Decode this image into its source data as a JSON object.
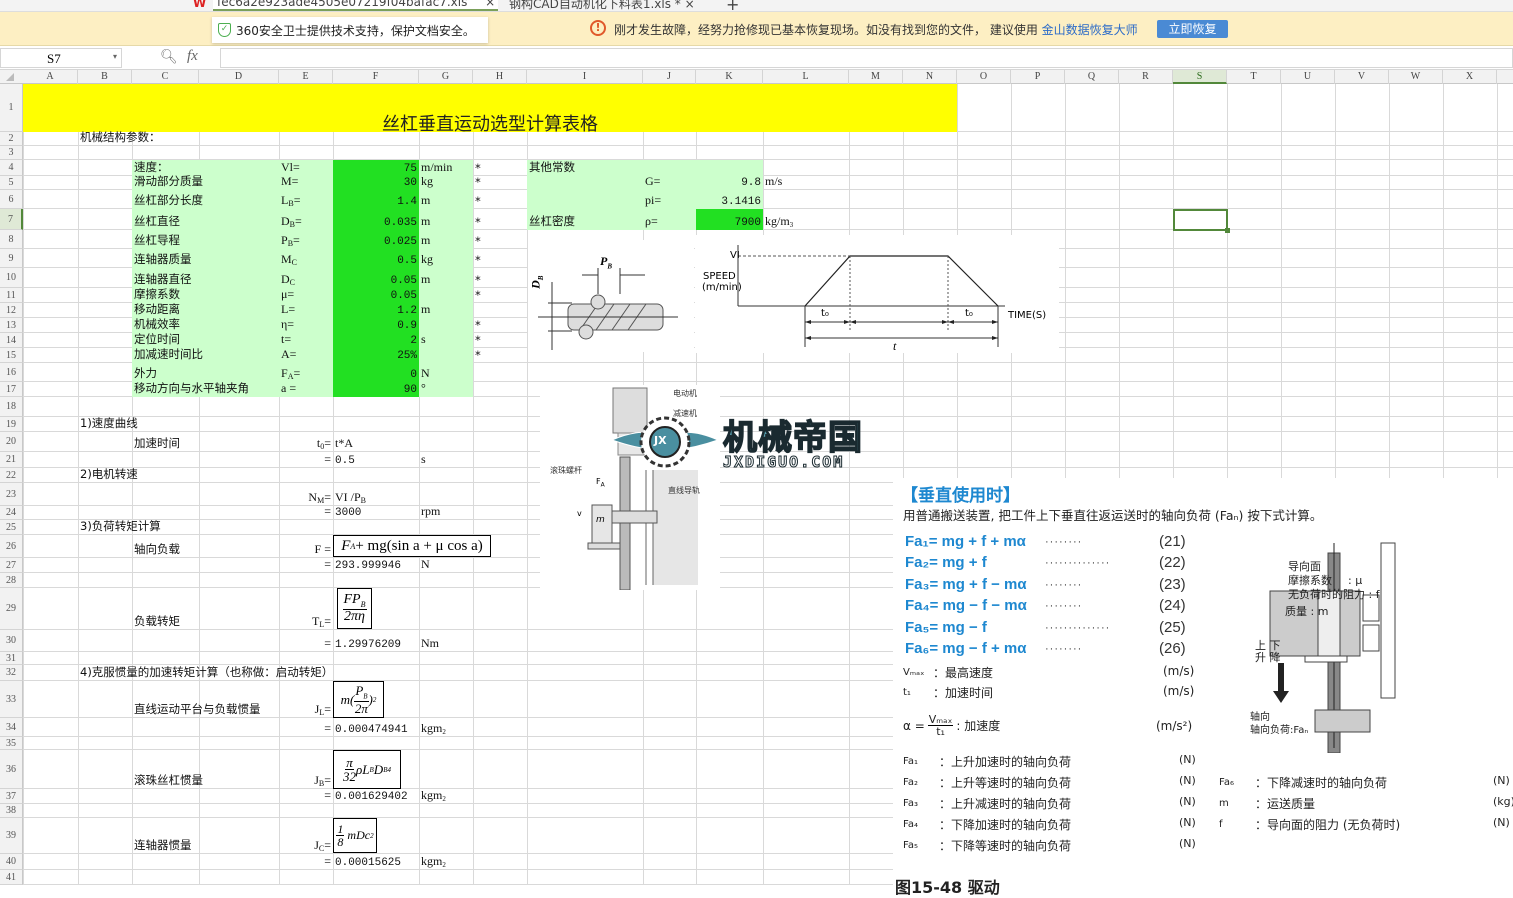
{
  "tabs": [
    {
      "label": "fec6a2e923ade4505e07219f04bafac7.xls",
      "close": "×"
    },
    {
      "label": "钢构CAD自动机化下料表1.xls *",
      "close": "×"
    }
  ],
  "tab_add": "+",
  "notice": {
    "security": "360安全卫士提供技术支持，保护文档安全。",
    "message": "刚才发生故障，经努力抢修现已基本恢复现场。如没有找到您的文件， 建议使用",
    "link": "金山数据恢复大师",
    "button": "立即恢复",
    "warning_color": "#e0582a",
    "button_color": "#4a8ad4"
  },
  "formula_bar": {
    "name_box": "S7",
    "fx": "fx",
    "value": ""
  },
  "columns": [
    "A",
    "B",
    "C",
    "D",
    "E",
    "F",
    "G",
    "H",
    "I",
    "J",
    "K",
    "L",
    "M",
    "N",
    "O",
    "P",
    "Q",
    "R",
    "S",
    "T",
    "U",
    "V",
    "W",
    "X"
  ],
  "selected_cell": {
    "col": "S",
    "row": 7
  },
  "sheet": {
    "title": "丝杠垂直运动选型计算表格",
    "cells": [
      {
        "ref": "B2",
        "text": "机械结构参数："
      },
      {
        "ref": "C4",
        "text": "速度："
      },
      {
        "ref": "E4",
        "text": "Vl="
      },
      {
        "ref": "F4",
        "text": "75"
      },
      {
        "ref": "G4",
        "text": "m/min"
      },
      {
        "ref": "H4",
        "text": "*"
      },
      {
        "ref": "C5",
        "text": "滑动部分质量"
      },
      {
        "ref": "E5",
        "text": "M="
      },
      {
        "ref": "F5",
        "text": "30"
      },
      {
        "ref": "G5",
        "text": "kg"
      },
      {
        "ref": "H5",
        "text": "*"
      },
      {
        "ref": "C6",
        "text": "丝杠部分长度"
      },
      {
        "ref": "E6",
        "text": "L",
        "sub": "B",
        "tail": "="
      },
      {
        "ref": "F6",
        "text": "1.4"
      },
      {
        "ref": "G6",
        "text": "m"
      },
      {
        "ref": "H6",
        "text": "*"
      },
      {
        "ref": "C7",
        "text": "丝杠直径"
      },
      {
        "ref": "E7",
        "text": "D",
        "sub": "B",
        "tail": "="
      },
      {
        "ref": "F7",
        "text": "0.035"
      },
      {
        "ref": "G7",
        "text": "m"
      },
      {
        "ref": "H7",
        "text": "*"
      },
      {
        "ref": "C8",
        "text": "丝杠导程"
      },
      {
        "ref": "E8",
        "text": "P",
        "sub": "B",
        "tail": "="
      },
      {
        "ref": "F8",
        "text": "0.025"
      },
      {
        "ref": "G8",
        "text": "m"
      },
      {
        "ref": "H8",
        "text": "*"
      },
      {
        "ref": "C9",
        "text": "连轴器质量"
      },
      {
        "ref": "E9",
        "text": "M",
        "sub": "C",
        "tail": ""
      },
      {
        "ref": "F9",
        "text": "0.5"
      },
      {
        "ref": "G9",
        "text": "kg"
      },
      {
        "ref": "H9",
        "text": "*"
      },
      {
        "ref": "C10",
        "text": "连轴器直径"
      },
      {
        "ref": "E10",
        "text": "D",
        "sub": "C",
        "tail": ""
      },
      {
        "ref": "F10",
        "text": "0.05"
      },
      {
        "ref": "G10",
        "text": "m"
      },
      {
        "ref": "H10",
        "text": "*"
      },
      {
        "ref": "C11",
        "text": "摩擦系数"
      },
      {
        "ref": "E11",
        "text": "μ="
      },
      {
        "ref": "F11",
        "text": "0.05"
      },
      {
        "ref": "H11",
        "text": "*"
      },
      {
        "ref": "C12",
        "text": "移动距离"
      },
      {
        "ref": "E12",
        "text": "L="
      },
      {
        "ref": "F12",
        "text": "1.2"
      },
      {
        "ref": "G12",
        "text": "m"
      },
      {
        "ref": "C13",
        "text": "机械效率"
      },
      {
        "ref": "E13",
        "text": "η="
      },
      {
        "ref": "F13",
        "text": "0.9"
      },
      {
        "ref": "H13",
        "text": "*"
      },
      {
        "ref": "C14",
        "text": "定位时间"
      },
      {
        "ref": "E14",
        "text": "t="
      },
      {
        "ref": "F14",
        "text": "2"
      },
      {
        "ref": "G14",
        "text": "s"
      },
      {
        "ref": "H14",
        "text": "*"
      },
      {
        "ref": "C15",
        "text": "加减速时间比"
      },
      {
        "ref": "E15",
        "text": "A="
      },
      {
        "ref": "F15",
        "text": "25%"
      },
      {
        "ref": "H15",
        "text": "*"
      },
      {
        "ref": "C16",
        "text": "外力"
      },
      {
        "ref": "E16",
        "text": "F",
        "sub": "A",
        "tail": "="
      },
      {
        "ref": "F16",
        "text": "0"
      },
      {
        "ref": "G16",
        "text": "N"
      },
      {
        "ref": "C17",
        "text": "移动方向与水平轴夹角"
      },
      {
        "ref": "E17",
        "text": "a ="
      },
      {
        "ref": "F17",
        "text": "90"
      },
      {
        "ref": "G17",
        "text": "°"
      },
      {
        "ref": "I4",
        "text": "其他常数"
      },
      {
        "ref": "J5",
        "text": "G="
      },
      {
        "ref": "K5",
        "text": "9.8"
      },
      {
        "ref": "L5",
        "text": "m/s"
      },
      {
        "ref": "J6",
        "text": "pi="
      },
      {
        "ref": "K6",
        "text": "3.1416"
      },
      {
        "ref": "I7",
        "text": "丝杠密度"
      },
      {
        "ref": "J7",
        "text": "ρ="
      },
      {
        "ref": "K7",
        "text": "7900"
      },
      {
        "ref": "L7",
        "text": "kg/m",
        "sup": "3"
      },
      {
        "ref": "B19",
        "text": "1)速度曲线"
      },
      {
        "ref": "C20",
        "text": "加速时间"
      },
      {
        "ref": "E20",
        "text": "t",
        "sub": "0",
        "tail": "="
      },
      {
        "ref": "F20",
        "text": "t*A"
      },
      {
        "ref": "E21",
        "text": "="
      },
      {
        "ref": "F21",
        "text": "0.5"
      },
      {
        "ref": "G21",
        "text": "s"
      },
      {
        "ref": "B22",
        "text": "2)电机转速"
      },
      {
        "ref": "E23",
        "text": "N",
        "sub": "M",
        "tail": "="
      },
      {
        "ref": "F23",
        "text": "VI /P",
        "sub": "B"
      },
      {
        "ref": "E24",
        "text": "="
      },
      {
        "ref": "F24",
        "text": "3000"
      },
      {
        "ref": "G24",
        "text": "rpm"
      },
      {
        "ref": "B25",
        "text": "3)负荷转矩计算"
      },
      {
        "ref": "C26",
        "text": "轴向负载"
      },
      {
        "ref": "E26",
        "text": "F ="
      },
      {
        "ref": "E27",
        "text": "="
      },
      {
        "ref": "F27",
        "text": "293.999946"
      },
      {
        "ref": "G27",
        "text": "N"
      },
      {
        "ref": "C29",
        "text": "负载转矩"
      },
      {
        "ref": "E29",
        "text": "T",
        "sub": "L",
        "tail": " ="
      },
      {
        "ref": "E30",
        "text": "="
      },
      {
        "ref": "F30",
        "text": "1.29976209"
      },
      {
        "ref": "G30",
        "text": "Nm"
      },
      {
        "ref": "B32",
        "text": "4)克服惯量的加速转矩计算（也称做：启动转矩）"
      },
      {
        "ref": "C33",
        "text": "直线运动平台与负载惯量"
      },
      {
        "ref": "E33",
        "text": "J",
        "sub": "L",
        "tail": "="
      },
      {
        "ref": "E34",
        "text": "="
      },
      {
        "ref": "F34",
        "text": "0.000474941"
      },
      {
        "ref": "G34",
        "text": "kgm",
        "sup": "2"
      },
      {
        "ref": "C36",
        "text": "滚珠丝杠惯量"
      },
      {
        "ref": "E36",
        "text": "J",
        "sub": "B",
        "tail": "="
      },
      {
        "ref": "E37",
        "text": "="
      },
      {
        "ref": "F37",
        "text": "0.001629402"
      },
      {
        "ref": "G37",
        "text": "kgm",
        "sup": "2"
      },
      {
        "ref": "C39",
        "text": "连轴器惯量"
      },
      {
        "ref": "E39",
        "text": "J",
        "sub": "C",
        "tail": "="
      },
      {
        "ref": "E40",
        "text": "="
      },
      {
        "ref": "F40",
        "text": "0.00015625"
      },
      {
        "ref": "G40",
        "text": "kgm",
        "sup": "2"
      }
    ],
    "formulas": {
      "axial_load": {
        "a": "F",
        "a_sub": "A",
        "b": " + mg(sin a + μ cos a)"
      },
      "load_torque": {
        "num": "FP",
        "num_sub": "B",
        "den": "2πη"
      },
      "linear_inertia": {
        "pre": "m(",
        "num": "P",
        "num_sub": "B",
        "den": "2π",
        "post": ")",
        "exp": "2"
      },
      "screw_inertia": {
        "num": "π",
        "den": "32",
        "post": "ρL",
        "post_sub": "B",
        "post2": "D",
        "post2_sub": "B",
        "exp": "4"
      },
      "coupling_inertia": {
        "num": "1",
        "den": "8",
        "post": "mDc",
        "exp": "2"
      }
    },
    "colors": {
      "title_fill": "#ffff00",
      "input_fill": "#ccffcc",
      "value_fill": "#22e022",
      "selection": "#52883a"
    }
  },
  "screw_diagram": {
    "pitch_label": "P",
    "pitch_sub": "B",
    "diameter_label": "D",
    "diameter_sub": "B"
  },
  "speed_diagram": {
    "vl": "VI",
    "ylabel1": "SPEED",
    "ylabel2": "(m/min)",
    "xlabel": "TIME(S)",
    "t0": "t₀",
    "t": "t"
  },
  "motor_diagram": {
    "motor": "电动机",
    "reducer": "减速机",
    "screw": "滚珠螺杆",
    "force": "F",
    "force_sub": "A",
    "rail": "直线导轨",
    "mass": "m",
    "velocity": "v"
  },
  "watermark": {
    "name": "机械帝国",
    "url": "JXDIGUO.COM",
    "emblem": "JX"
  },
  "reference_doc": {
    "heading": "【垂直使用时】",
    "intro": "用普通搬送装置, 把工件上下垂直往返运送时的轴向负荷 (Faₙ) 按下式计算。",
    "equations": [
      {
        "lhs": "Fa₁= mg + f + mα",
        "num": "(21)"
      },
      {
        "lhs": "Fa₂= mg + f",
        "num": "(22)"
      },
      {
        "lhs": "Fa₃= mg + f − mα",
        "num": "(23)"
      },
      {
        "lhs": "Fa₄= mg − f − mα",
        "num": "(24)"
      },
      {
        "lhs": "Fa₅= mg − f",
        "num": "(25)"
      },
      {
        "lhs": "Fa₆= mg − f + mα",
        "num": "(26)"
      }
    ],
    "vars": [
      {
        "sym": "Vₘₐₓ",
        "desc": "：最高速度",
        "unit": "(m/s)"
      },
      {
        "sym": "t₁",
        "desc": "：加速时间",
        "unit": "(m/s)"
      }
    ],
    "accel": {
      "lhs": "α =",
      "num": "Vₘₐₓ",
      "den": "t₁",
      "desc": ": 加速度",
      "unit": "(m/s²)"
    },
    "defs_left": [
      {
        "sym": "Fa₁",
        "desc": "：上升加速时的轴向负荷",
        "unit": "(N)"
      },
      {
        "sym": "Fa₂",
        "desc": "：上升等速时的轴向负荷",
        "unit": "(N)"
      },
      {
        "sym": "Fa₃",
        "desc": "：上升减速时的轴向负荷",
        "unit": "(N)"
      },
      {
        "sym": "Fa₄",
        "desc": "：下降加速时的轴向负荷",
        "unit": "(N)"
      },
      {
        "sym": "Fa₅",
        "desc": "：下降等速时的轴向负荷",
        "unit": "(N)"
      }
    ],
    "defs_right": [
      {
        "sym": "Fa₆",
        "desc": "：下降减速时的轴向负荷",
        "unit": "(N)"
      },
      {
        "sym": "m",
        "desc": "：运送质量",
        "unit": "(kg)"
      },
      {
        "sym": "f",
        "desc": "：导向面的阻力 (无负荷时)",
        "unit": "(N)"
      }
    ],
    "figure": {
      "guide": "导向面",
      "friction": "摩擦系数",
      "friction_sym": ": μ",
      "resistance": "无负荷时的阻力 : f",
      "mass": "质量 : m",
      "up": "上",
      "down": "下",
      "rise": "升",
      "fall": "降",
      "axial": "轴向",
      "axial_load": "轴向负荷:Faₙ"
    },
    "footer": "图15-48 驱动",
    "accent": "#1e88d0"
  }
}
